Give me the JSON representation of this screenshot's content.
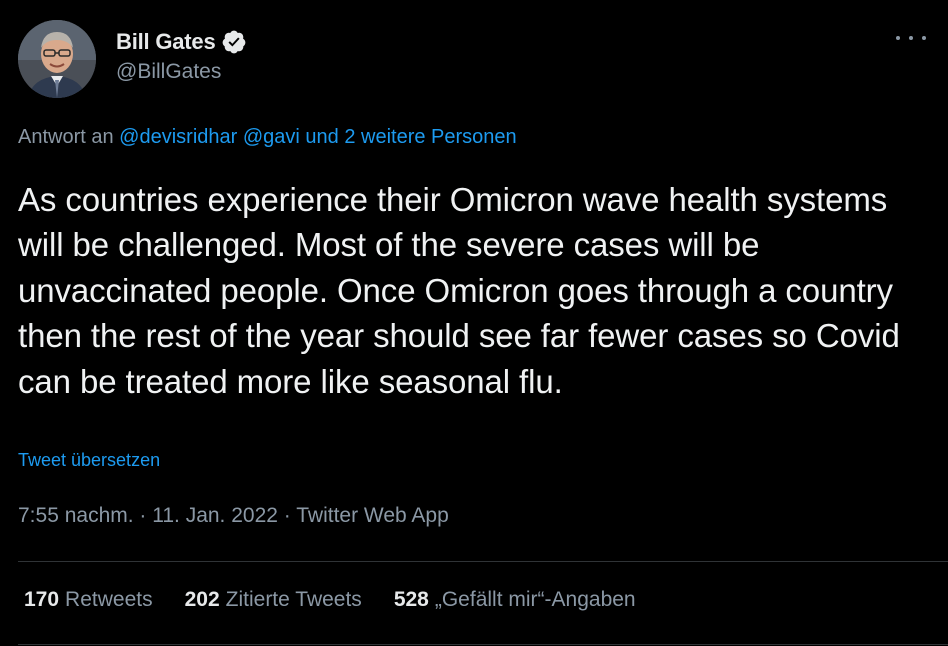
{
  "author": {
    "name": "Bill Gates",
    "handle": "@BillGates",
    "verified": true
  },
  "reply": {
    "prefix": "Antwort an",
    "mentions": "@devisridhar @gavi und 2 weitere Personen"
  },
  "tweet": {
    "text": "As countries experience their Omicron wave health systems will be challenged. Most of the severe cases will be unvaccinated people. Once Omicron goes through a country then the rest of the year should see far fewer cases so Covid can be treated more like seasonal flu.",
    "translate_label": "Tweet übersetzen",
    "meta": "7:55 nachm. · 11. Jan. 2022 · Twitter Web App"
  },
  "stats": [
    {
      "count": "170",
      "label": "Retweets"
    },
    {
      "count": "202",
      "label": "Zitierte Tweets"
    },
    {
      "count": "528",
      "label": "„Gefällt mir“-Angaben"
    }
  ],
  "icons": {
    "more": "more-options-icon",
    "verified": "verified-badge-icon"
  },
  "colors": {
    "background": "#000000",
    "text": "#e7e9ea",
    "secondary": "#8b98a5",
    "link": "#1d9bf0",
    "divider": "#2f3336"
  }
}
